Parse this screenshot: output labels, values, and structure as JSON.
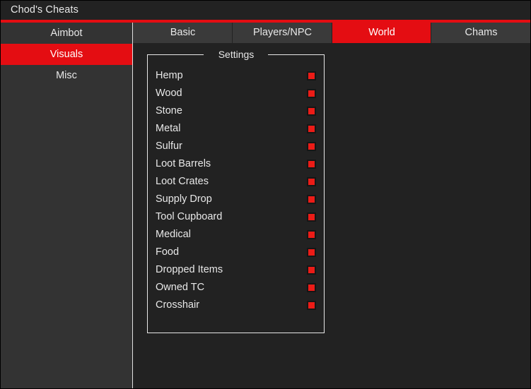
{
  "window": {
    "title": "Chod's Cheats",
    "accent_color": "#e40d12",
    "background_color": "#222222",
    "sidebar_color": "#333333"
  },
  "sidebar": {
    "items": [
      {
        "label": "Aimbot",
        "active": false
      },
      {
        "label": "Visuals",
        "active": true
      },
      {
        "label": "Misc",
        "active": false
      }
    ]
  },
  "tabs": [
    {
      "label": "Basic",
      "active": false
    },
    {
      "label": "Players/NPC",
      "active": false
    },
    {
      "label": "World",
      "active": true
    },
    {
      "label": "Chams",
      "active": false
    }
  ],
  "settings_group": {
    "legend": "Settings",
    "rows": [
      {
        "label": "Hemp",
        "checked": true
      },
      {
        "label": "Wood",
        "checked": true
      },
      {
        "label": "Stone",
        "checked": true
      },
      {
        "label": "Metal",
        "checked": true
      },
      {
        "label": "Sulfur",
        "checked": true
      },
      {
        "label": "Loot Barrels",
        "checked": true
      },
      {
        "label": "Loot Crates",
        "checked": true
      },
      {
        "label": "Supply Drop",
        "checked": true
      },
      {
        "label": "Tool Cupboard",
        "checked": true
      },
      {
        "label": "Medical",
        "checked": true
      },
      {
        "label": "Food",
        "checked": true
      },
      {
        "label": "Dropped Items",
        "checked": true
      },
      {
        "label": "Owned TC",
        "checked": true
      },
      {
        "label": "Crosshair",
        "checked": true
      }
    ]
  }
}
